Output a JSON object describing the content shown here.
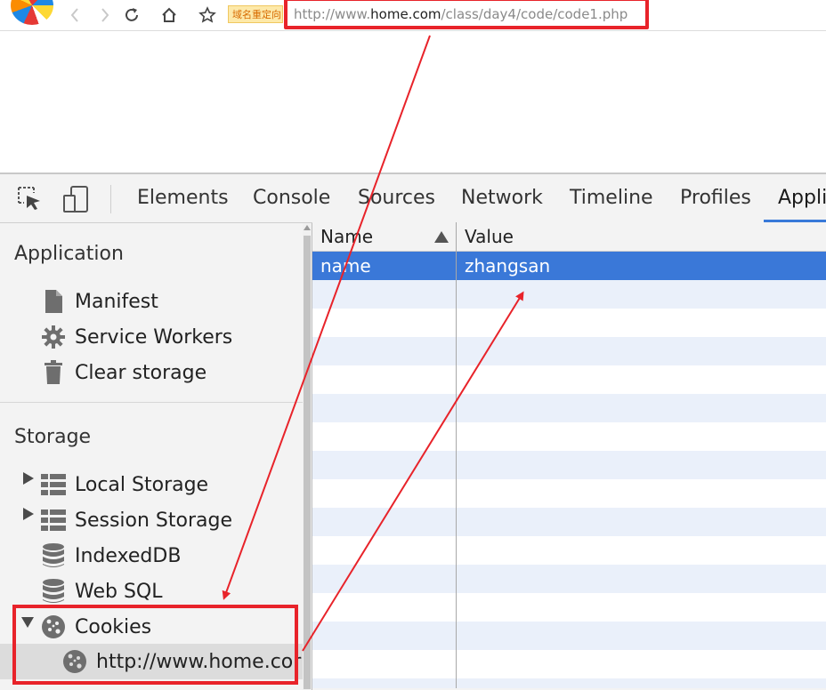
{
  "browser": {
    "redirect_badge": "域名重定向",
    "url_prefix": "http://www.",
    "url_host": "home.com",
    "url_path": "/class/day4/code/code1.php"
  },
  "devtools": {
    "tabs": [
      "Elements",
      "Console",
      "Sources",
      "Network",
      "Timeline",
      "Profiles",
      "Appli"
    ],
    "active_tab": "Appli"
  },
  "sidebar": {
    "application_title": "Application",
    "application_items": [
      "Manifest",
      "Service Workers",
      "Clear storage"
    ],
    "storage_title": "Storage",
    "storage_items": [
      "Local Storage",
      "Session Storage",
      "IndexedDB",
      "Web SQL",
      "Cookies"
    ],
    "cookie_child": "http://www.home.cor"
  },
  "table": {
    "columns": [
      "Name",
      "Value"
    ],
    "rows": [
      {
        "name": "name",
        "value": "zhangsan"
      }
    ]
  },
  "colors": {
    "annotation": "#e8232a",
    "selection": "#3a78d8",
    "stripe": "#eaf0fa",
    "tab_accent": "#3879d9"
  }
}
